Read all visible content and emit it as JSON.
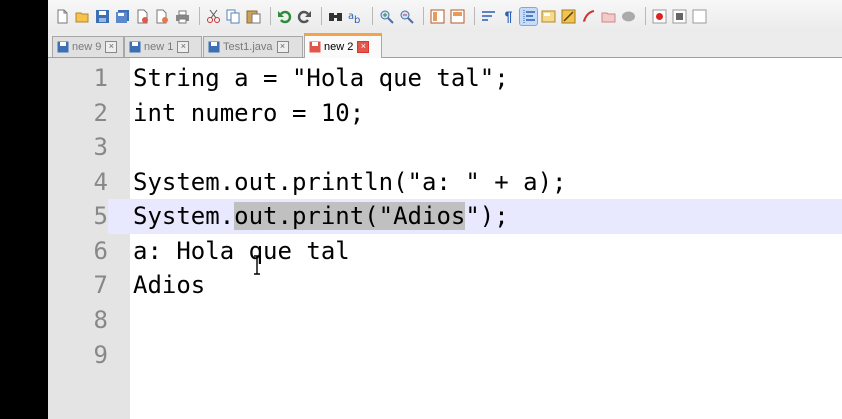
{
  "toolbar": {
    "icons": [
      "new-file-icon",
      "open-file-icon",
      "save-icon",
      "save-all-icon",
      "close-icon",
      "close-all-icon",
      "print-icon",
      "cut-icon",
      "copy-icon",
      "paste-icon",
      "undo-icon",
      "redo-icon",
      "find-icon",
      "replace-icon",
      "zoom-in-icon",
      "zoom-out-icon",
      "sync-vertical-icon",
      "sync-horizontal-icon",
      "word-wrap-icon",
      "show-all-chars-icon",
      "indent-guide-icon",
      "doc-map-icon",
      "function-list-icon",
      "folder-workspace-icon",
      "monitoring-icon",
      "record-macro-icon",
      "stop-record-icon"
    ]
  },
  "tabs": [
    {
      "label": "new 9",
      "active": false
    },
    {
      "label": "new 1",
      "active": false
    },
    {
      "label": "Test1.java",
      "active": false
    },
    {
      "label": "new 2",
      "active": true
    }
  ],
  "editor": {
    "lines": [
      {
        "num": "1",
        "text": "String a = \"Hola que tal\";"
      },
      {
        "num": "2",
        "text": "int numero = 10;"
      },
      {
        "num": "3",
        "text": ""
      },
      {
        "num": "4",
        "text": "System.out.println(\"a: \" + a);"
      },
      {
        "num": "5",
        "pre": "System.",
        "sel": "out.print(\"Adios",
        "post": "\");"
      },
      {
        "num": "6",
        "text": "a: Hola que tal"
      },
      {
        "num": "7",
        "text": "Adios"
      },
      {
        "num": "8",
        "text": ""
      },
      {
        "num": "9",
        "text": ""
      }
    ],
    "current_line": "5"
  },
  "colors": {
    "active_tab_accent": "#f4a447",
    "current_line_bg": "#e8e8ff",
    "selection_bg": "#c0c0c0"
  }
}
